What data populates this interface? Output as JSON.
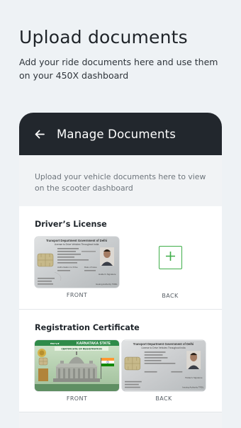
{
  "intro_screen": {
    "title": "Upload documents",
    "subtitle": "Add your ride documents here and use them on your 450X dashboard"
  },
  "app": {
    "header_title": "Manage Documents",
    "back_icon": "arrow-left-icon",
    "instructions": "Upload your vehicle documents here to view on the scooter dashboard"
  },
  "documents": [
    {
      "title": "Driver’s License",
      "front": {
        "label": "FRONT",
        "card": {
          "header1": "Transport Department Government of Delhi",
          "header2": "License to Drive Vehicles Throughout India",
          "auth_label": "Authorisation to Drive",
          "date_label": "Date of Issue",
          "sign_label": "Holder's Signature",
          "issuing_label": "Issuing Authority TRDL"
        }
      },
      "back": {
        "label": "BACK",
        "add_icon": "plus-icon"
      }
    },
    {
      "title": "Registration Certificate",
      "front": {
        "label": "FRONT",
        "card": {
          "state": "KARNATAKA STATE",
          "certificate": "CERTIFICATE OF REGISTRATION"
        }
      },
      "back": {
        "label": "BACK",
        "card": {
          "header1": "Transport Department Government of Delhi",
          "header2": "License to Drive Vehicles Throughout India",
          "sign_label": "Holder's Signature",
          "issuing_label": "Issuing Authority TRDL"
        }
      }
    }
  ],
  "colors": {
    "background": "#eef2f5",
    "header": "#22272d",
    "accent_green": "#3fae49",
    "rc_green": "#2e8b49"
  }
}
